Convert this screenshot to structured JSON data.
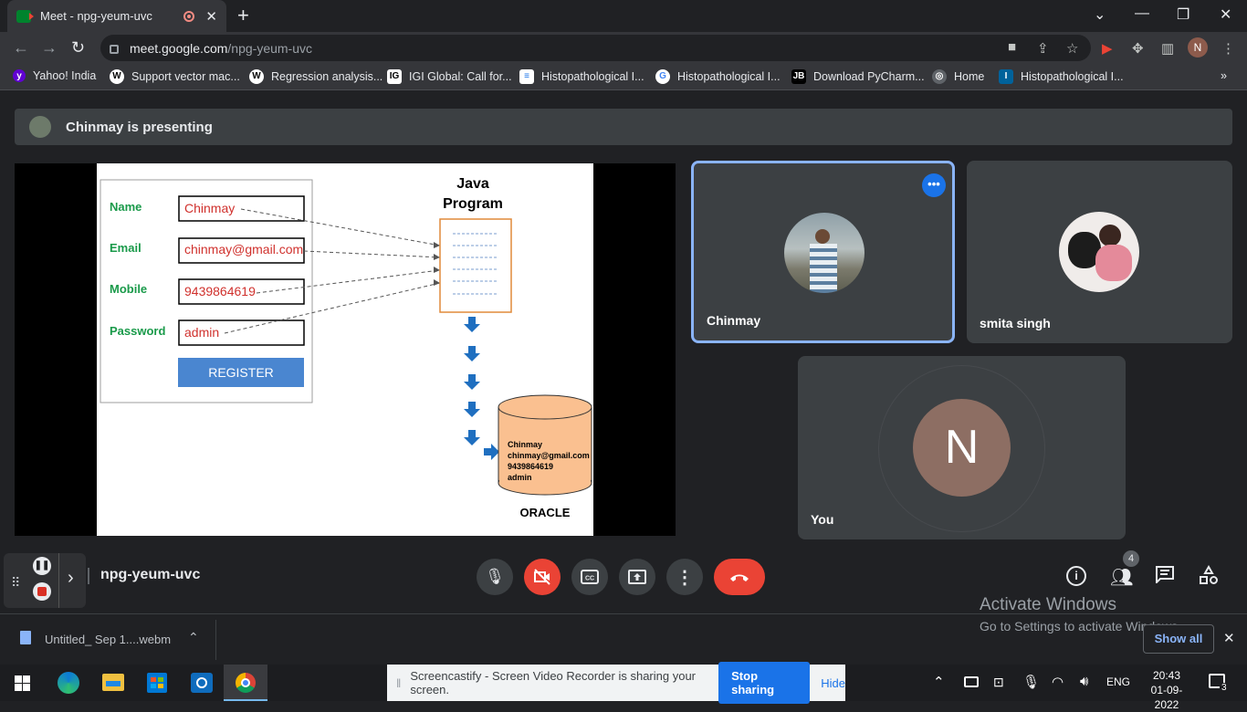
{
  "browser": {
    "tab_title": "Meet - npg-yeum-uvc",
    "new_tab": "+",
    "url_host": "meet.google.com",
    "url_path": "/npg-yeum-uvc",
    "profile_initial": "N"
  },
  "bookmarks": [
    {
      "label": "Yahoo! India",
      "icon": "yahoo-icon",
      "color": "#6001d2"
    },
    {
      "label": "Support vector mac...",
      "icon": "wikipedia-icon",
      "color": "#ffffff"
    },
    {
      "label": "Regression analysis...",
      "icon": "wikipedia-icon",
      "color": "#ffffff"
    },
    {
      "label": "IGI Global: Call for...",
      "icon": "igi-icon",
      "color": "#ffffff"
    },
    {
      "label": "Histopathological I...",
      "icon": "doc-icon",
      "color": "#ffffff"
    },
    {
      "label": "Histopathological I...",
      "icon": "google-icon",
      "color": "#ffffff"
    },
    {
      "label": "Download PyCharm...",
      "icon": "jetbrains-icon",
      "color": "#000000"
    },
    {
      "label": "Home",
      "icon": "globe-icon",
      "color": "#5f6368"
    },
    {
      "label": "Histopathological I...",
      "icon": "ieee-icon",
      "color": "#00629b"
    }
  ],
  "meet": {
    "presenting_text": "Chinmay is presenting",
    "meeting_code": "npg-yeum-uvc",
    "participants_count": "4",
    "tiles": [
      {
        "name": "Chinmay"
      },
      {
        "name": "smita singh"
      },
      {
        "name": "You",
        "initial": "N"
      }
    ],
    "activate_title": "Activate Windows",
    "activate_sub": "Go to Settings to activate Windows."
  },
  "slide": {
    "form_labels": [
      "Name",
      "Email",
      "Mobile",
      "Password"
    ],
    "form_values": [
      "Chinmay",
      "chinmay@gmail.com",
      "9439864619",
      "admin"
    ],
    "register_label": "REGISTER",
    "program_title_1": "Java",
    "program_title_2": "Program",
    "db_lines": [
      "Chinmay",
      "chinmay@gmail.com",
      "9439864619",
      "admin"
    ],
    "db_label": "ORACLE"
  },
  "downloads": {
    "file_name": "Untitled_ Sep 1....webm",
    "show_all": "Show all"
  },
  "share": {
    "message": "Screencastify - Screen Video Recorder is sharing your screen.",
    "stop_label": "Stop sharing",
    "hide_label": "Hide"
  },
  "taskbar": {
    "lang": "ENG",
    "time": "20:43",
    "date": "01-09-2022",
    "notif_count": "3"
  }
}
